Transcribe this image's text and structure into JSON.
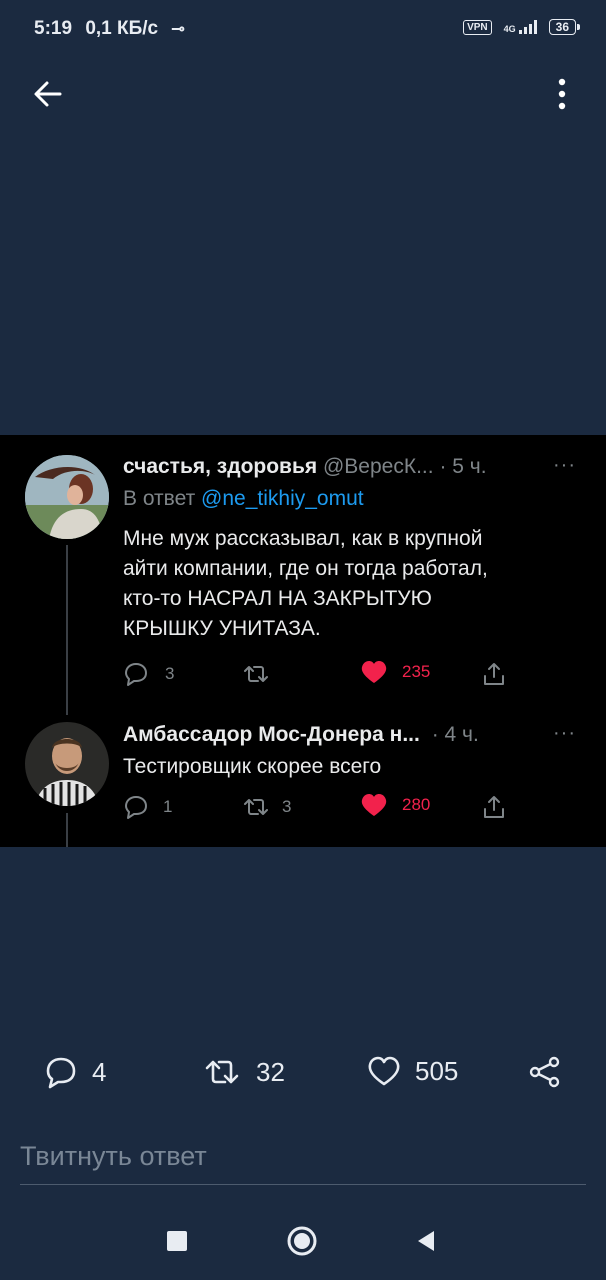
{
  "status_bar": {
    "time": "5:19",
    "speed": "0,1 КБ/с",
    "vpn": "VPN",
    "network": "4G",
    "battery": "36"
  },
  "top_bar": {
    "back_icon": "arrow-left-icon",
    "menu_icon": "more-vertical-icon"
  },
  "tweets": [
    {
      "name": "счастья, здоровья",
      "handle": "@ВересК...",
      "time": "· 5 ч.",
      "more": "···",
      "reply_label": "В ответ",
      "reply_to": "@ne_tikhiy_omut",
      "lines": [
        "Мне муж рассказывал, как в крупной",
        "айти компании, где он тогда работал,",
        "кто-то НАСРАЛ НА ЗАКРЫТУЮ",
        "КРЫШКУ УНИТАЗА."
      ],
      "replies": "3",
      "retweets": "",
      "likes": "235"
    },
    {
      "name": "Амбассадор Мос-Донера н...",
      "time": "· 4 ч.",
      "more": "···",
      "text": "Тестировщик скорее всего",
      "replies": "1",
      "retweets": "3",
      "likes": "280"
    }
  ],
  "stats": {
    "replies": "4",
    "retweets": "32",
    "likes": "505"
  },
  "reply_box": {
    "placeholder": "Твитнуть ответ"
  },
  "colors": {
    "background": "#1b2a40",
    "accent": "#1d9bf0",
    "like": "#f2224c"
  }
}
